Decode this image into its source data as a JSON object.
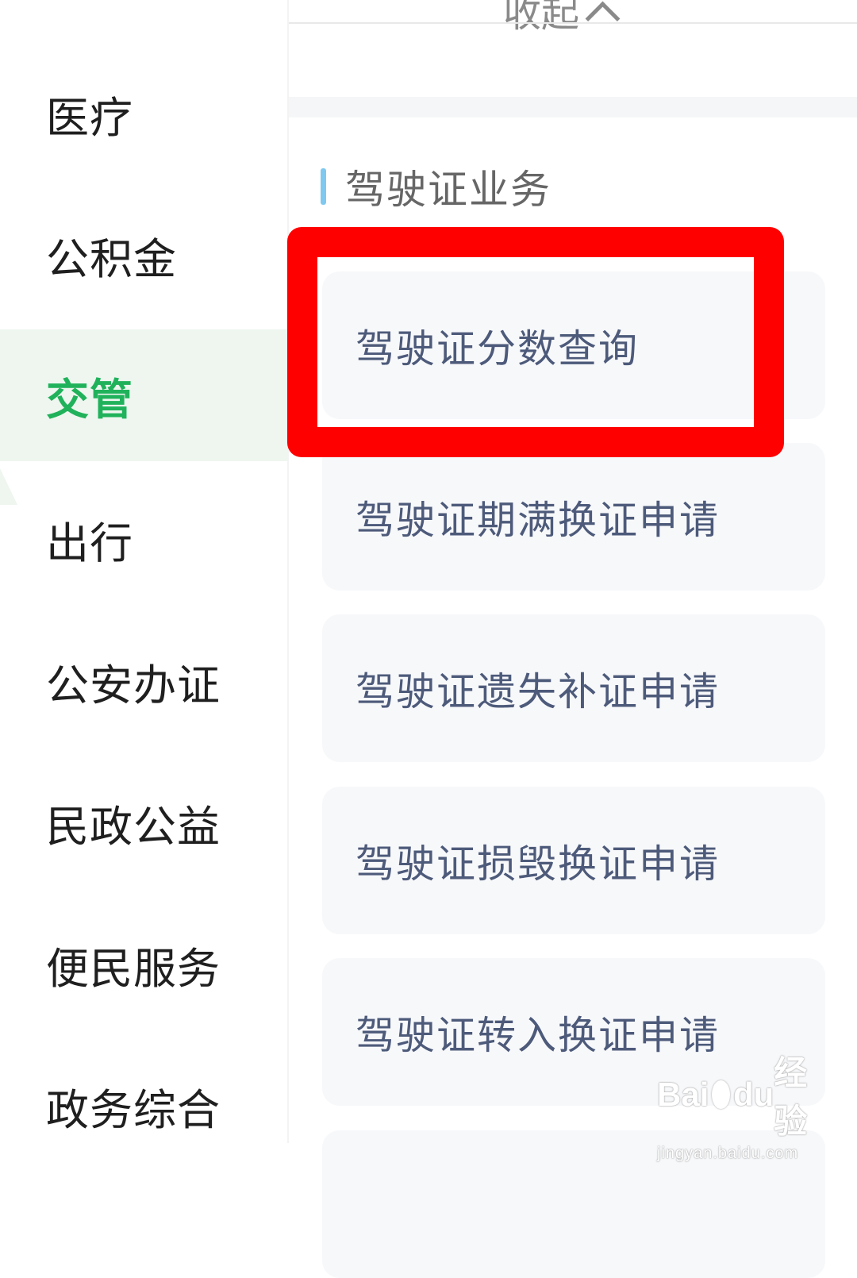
{
  "sidebar": {
    "items": [
      {
        "label": "医疗"
      },
      {
        "label": "公积金"
      },
      {
        "label": "交管"
      },
      {
        "label": "出行"
      },
      {
        "label": "公安办证"
      },
      {
        "label": "民政公益"
      },
      {
        "label": "便民服务"
      },
      {
        "label": "政务综合"
      }
    ],
    "active_label": "交管",
    "active_color": "#20b25b"
  },
  "main": {
    "collapse_label": "收起",
    "section_title": "驾驶证业务",
    "section_accent": "#7fc8f0",
    "cards": [
      {
        "label": "驾驶证分数查询"
      },
      {
        "label": "驾驶证期满换证申请"
      },
      {
        "label": "驾驶证遗失补证申请"
      },
      {
        "label": "驾驶证损毁换证申请"
      },
      {
        "label": "驾驶证转入换证申请"
      }
    ]
  },
  "annotation": {
    "highlight_color": "#ff0000"
  },
  "watermark": {
    "main_left": "Bai",
    "main_mid": "du",
    "main_right": "经验",
    "sub": "jingyan.baidu.com"
  }
}
